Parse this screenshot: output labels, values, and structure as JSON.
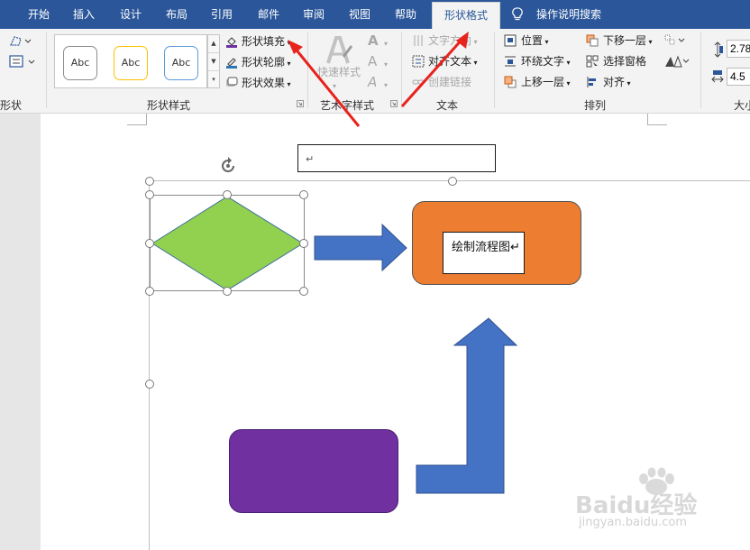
{
  "tabs": [
    {
      "label": "开始"
    },
    {
      "label": "插入"
    },
    {
      "label": "设计"
    },
    {
      "label": "布局"
    },
    {
      "label": "引用"
    },
    {
      "label": "邮件"
    },
    {
      "label": "审阅"
    },
    {
      "label": "视图"
    },
    {
      "label": "帮助"
    },
    {
      "label": "形状格式",
      "active": true
    }
  ],
  "tell_me": "操作说明搜索",
  "ribbon": {
    "insert_shapes_label": "形状",
    "shape_styles": {
      "label": "形状样式",
      "gallery": [
        "Abc",
        "Abc",
        "Abc"
      ],
      "gallery_outline_colors": [
        "#8c8c8c",
        "#ffc000",
        "#5b9bd5"
      ],
      "fill": "形状填充",
      "outline": "形状轮廓",
      "effects": "形状效果",
      "fill_icon_color": "#7030a0",
      "outline_icon_color": "#2e75b6"
    },
    "wordart_styles": {
      "label": "艺术字样式",
      "quick_styles": "快速样式"
    },
    "text": {
      "label": "文本",
      "direction": "文字方向",
      "align": "对齐文本",
      "create_link": "创建链接"
    },
    "arrange": {
      "label": "排列",
      "position": "位置",
      "wrap_text": "环绕文字",
      "bring_forward": "上移一层",
      "send_backward": "下移一层",
      "selection_pane": "选择窗格",
      "align": "对齐"
    },
    "size": {
      "label": "大小",
      "height": "2.78",
      "width": "4.5"
    }
  },
  "document": {
    "textbox_top_mark": "↵",
    "inner_textbox_text": "绘制流程图↵"
  },
  "shapes": {
    "diamond_color": "#92d050",
    "arrow_color": "#4472c4",
    "orange_color": "#ed7d31",
    "purple_color": "#7030a0"
  },
  "annotation_color": "#e8221c",
  "watermark": {
    "brand": "Baidu经验",
    "url": "jingyan.baidu.com"
  }
}
